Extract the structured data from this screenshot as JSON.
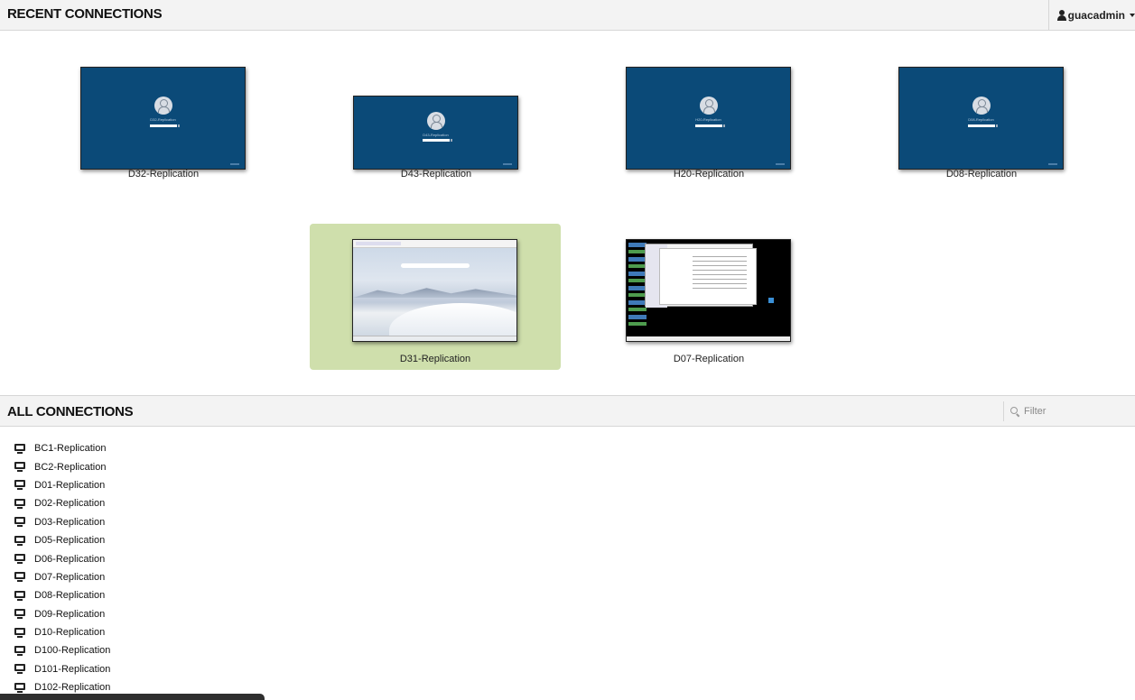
{
  "recent": {
    "title": "RECENT CONNECTIONS",
    "tiles": [
      {
        "label": "D32-Replication",
        "thumb": "lock-screen",
        "lock_name": "D32-Replication"
      },
      {
        "label": "D43-Replication",
        "thumb": "lock-screen",
        "lock_name": "D43-Replication"
      },
      {
        "label": "H20-Replication",
        "thumb": "lock-screen",
        "lock_name": "H20-Replication"
      },
      {
        "label": "D08-Replication",
        "thumb": "lock-screen",
        "lock_name": "D08-Replication"
      },
      {
        "label": "D31-Replication",
        "thumb": "desktop-dunes",
        "selected": true
      },
      {
        "label": "D07-Replication",
        "thumb": "desktop-windows"
      }
    ]
  },
  "user_menu": {
    "username": "guacadmin"
  },
  "all": {
    "title": "ALL CONNECTIONS",
    "filter_placeholder": "Filter",
    "connections": [
      "BC1-Replication",
      "BC2-Replication",
      "D01-Replication",
      "D02-Replication",
      "D03-Replication",
      "D05-Replication",
      "D06-Replication",
      "D07-Replication",
      "D08-Replication",
      "D09-Replication",
      "D10-Replication",
      "D100-Replication",
      "D101-Replication",
      "D102-Replication"
    ]
  },
  "colors": {
    "selected_tile": "#cfdfac",
    "lock_screen": "#0b4a78",
    "header_bg": "#f3f3f3"
  },
  "icons": {
    "user": "user-icon",
    "caret": "chevron-down-icon",
    "filter": "search-icon",
    "connection": "monitor-icon"
  }
}
